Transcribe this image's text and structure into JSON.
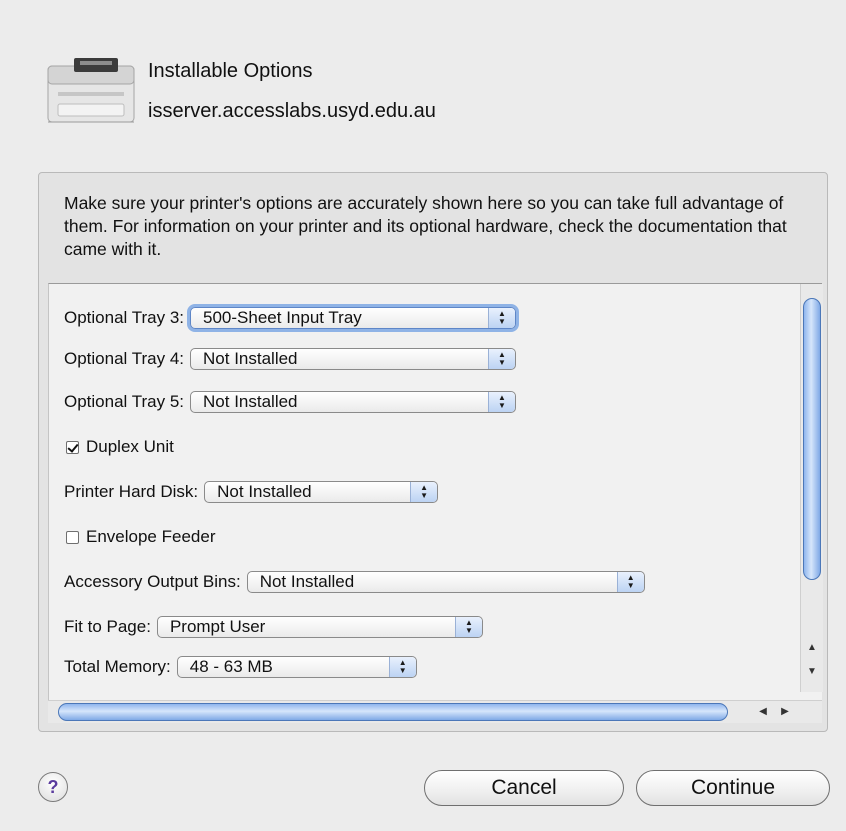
{
  "header": {
    "title": "Installable Options",
    "host": "isserver.accesslabs.usyd.edu.au",
    "icon": "printer-icon"
  },
  "intro_text": "Make sure your printer's options are accurately shown here so you can take full advantage of them.  For information on your printer and its optional hardware, check the documentation that came with it.",
  "options": {
    "tray3": {
      "label": "Optional Tray 3:",
      "value": "500-Sheet Input Tray"
    },
    "tray4": {
      "label": "Optional Tray 4:",
      "value": "Not Installed"
    },
    "tray5": {
      "label": "Optional Tray 5:",
      "value": "Not Installed"
    },
    "duplex": {
      "label": "Duplex Unit",
      "checked": true
    },
    "hard_disk": {
      "label": "Printer Hard Disk:",
      "value": "Not Installed"
    },
    "envelope": {
      "label": "Envelope Feeder",
      "checked": false
    },
    "output_bins": {
      "label": "Accessory Output Bins:",
      "value": "Not Installed"
    },
    "fit_to_page": {
      "label": "Fit to Page:",
      "value": "Prompt User"
    },
    "memory": {
      "label": "Total Memory:",
      "value": "48 - 63 MB"
    }
  },
  "buttons": {
    "help": "?",
    "cancel": "Cancel",
    "continue": "Continue"
  },
  "colors": {
    "accent": "#8fb6ee",
    "window_bg": "#ececec"
  }
}
